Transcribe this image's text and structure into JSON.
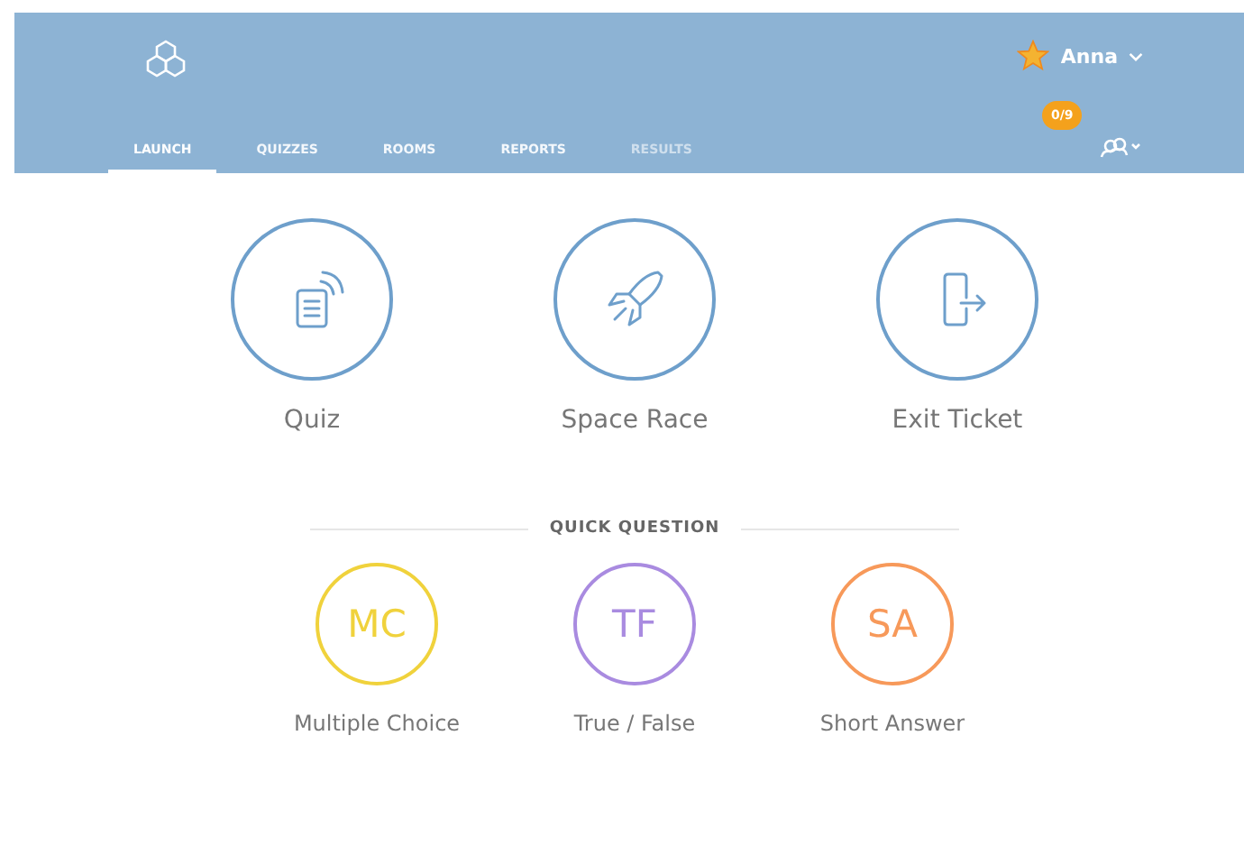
{
  "header": {
    "user": {
      "name": "Anna"
    },
    "badge": "0/9"
  },
  "tabs": [
    {
      "label": "LAUNCH",
      "selected": true,
      "disabled": false
    },
    {
      "label": "QUIZZES",
      "selected": false,
      "disabled": false
    },
    {
      "label": "ROOMS",
      "selected": false,
      "disabled": false
    },
    {
      "label": "REPORTS",
      "selected": false,
      "disabled": false
    },
    {
      "label": "RESULTS",
      "selected": false,
      "disabled": true
    }
  ],
  "launch": [
    {
      "kind": "quiz",
      "label": "Quiz"
    },
    {
      "kind": "rocket",
      "label": "Space Race"
    },
    {
      "kind": "exit",
      "label": "Exit Ticket"
    }
  ],
  "quick_question": {
    "title": "QUICK QUESTION",
    "items": [
      {
        "abbr": "MC",
        "label": "Multiple Choice",
        "color": "#f0d23c"
      },
      {
        "abbr": "TF",
        "label": "True / False",
        "color": "#a98be0"
      },
      {
        "abbr": "SA",
        "label": "Short Answer",
        "color": "#f7995a"
      }
    ]
  }
}
